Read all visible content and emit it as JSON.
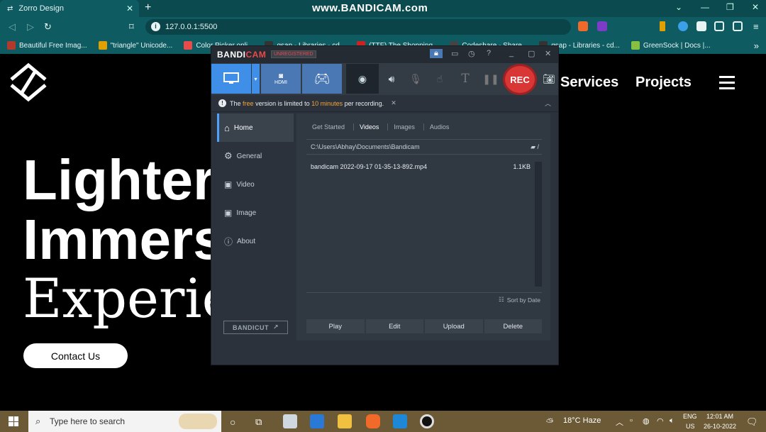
{
  "browser": {
    "tab_title": "Zorro Design",
    "tab_close": "✕",
    "new_tab": "+",
    "watermark": "www.BANDICAM.com",
    "url": "127.0.0.1:5500",
    "bookmarks": [
      {
        "label": "Beautiful Free Imag...",
        "color": "#b03a2e"
      },
      {
        "label": "\"triangle\" Unicode...",
        "color": "#e0a000"
      },
      {
        "label": "Color Picker onli...",
        "color": "#e94a4a"
      },
      {
        "label": "gsap - Libraries - cd...",
        "color": "#333333"
      },
      {
        "label": "(TTF) The Shopping...",
        "color": "#cc2222"
      },
      {
        "label": "Codeshare - Share...",
        "color": "#444444"
      },
      {
        "label": "gsap - Libraries - cd...",
        "color": "#333333"
      },
      {
        "label": "GreenSock | Docs |...",
        "color": "#88c041"
      }
    ]
  },
  "site": {
    "nav": [
      "Services",
      "Projects"
    ],
    "hero_lines": [
      "Lighter",
      "Immers",
      "Experien"
    ],
    "contact_label": "Contact Us"
  },
  "bandicam": {
    "brand_a": "BANDI",
    "brand_b": "CAM",
    "unregistered": "UNREGISTERED",
    "toolbar": {
      "hdmi": "HDMI",
      "rec": "REC"
    },
    "notice": {
      "pre": "The",
      "free": "free",
      "mid": "version is limited to",
      "limit": "10 minutes",
      "post": "per recording."
    },
    "sidebar": [
      "Home",
      "General",
      "Video",
      "Image",
      "About"
    ],
    "bandicut": "BANDICUT",
    "subtabs": [
      "Get Started",
      "Videos",
      "Images",
      "Audios"
    ],
    "path": "C:\\Users\\Abhay\\Documents\\Bandicam",
    "path_suffix": "/",
    "file": {
      "name": "bandicam 2022-09-17 01-35-13-892.mp4",
      "size": "1.1KB"
    },
    "sort": "Sort by Date",
    "actions": [
      "Play",
      "Edit",
      "Upload",
      "Delete"
    ]
  },
  "taskbar": {
    "search_placeholder": "Type here to search",
    "weather": "18°C  Haze",
    "lang": "ENG",
    "region": "US",
    "time": "12:01 AM",
    "date": "26-10-2022"
  }
}
